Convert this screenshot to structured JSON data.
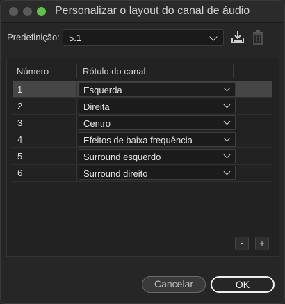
{
  "window": {
    "title": "Personalizar o layout do canal de áudio"
  },
  "preset": {
    "label": "Predefinição:",
    "value": "5.1",
    "save_icon": "save-preset-icon",
    "delete_icon": "trash-icon"
  },
  "table": {
    "columns": [
      "Número",
      "Rótulo do canal"
    ],
    "rows": [
      {
        "number": "1",
        "label": "Esquerda",
        "selected": true
      },
      {
        "number": "2",
        "label": "Direita",
        "selected": false
      },
      {
        "number": "3",
        "label": "Centro",
        "selected": false
      },
      {
        "number": "4",
        "label": "Efeitos de baixa frequência",
        "selected": false
      },
      {
        "number": "5",
        "label": "Surround esquerdo",
        "selected": false
      },
      {
        "number": "6",
        "label": "Surround direito",
        "selected": false
      }
    ]
  },
  "controls": {
    "remove_label": "-",
    "add_label": "+"
  },
  "buttons": {
    "cancel": "Cancelar",
    "ok": "OK"
  },
  "colors": {
    "window_bg": "#262626",
    "selected_row": "#464646",
    "zoom_light": "#5fc24a"
  }
}
